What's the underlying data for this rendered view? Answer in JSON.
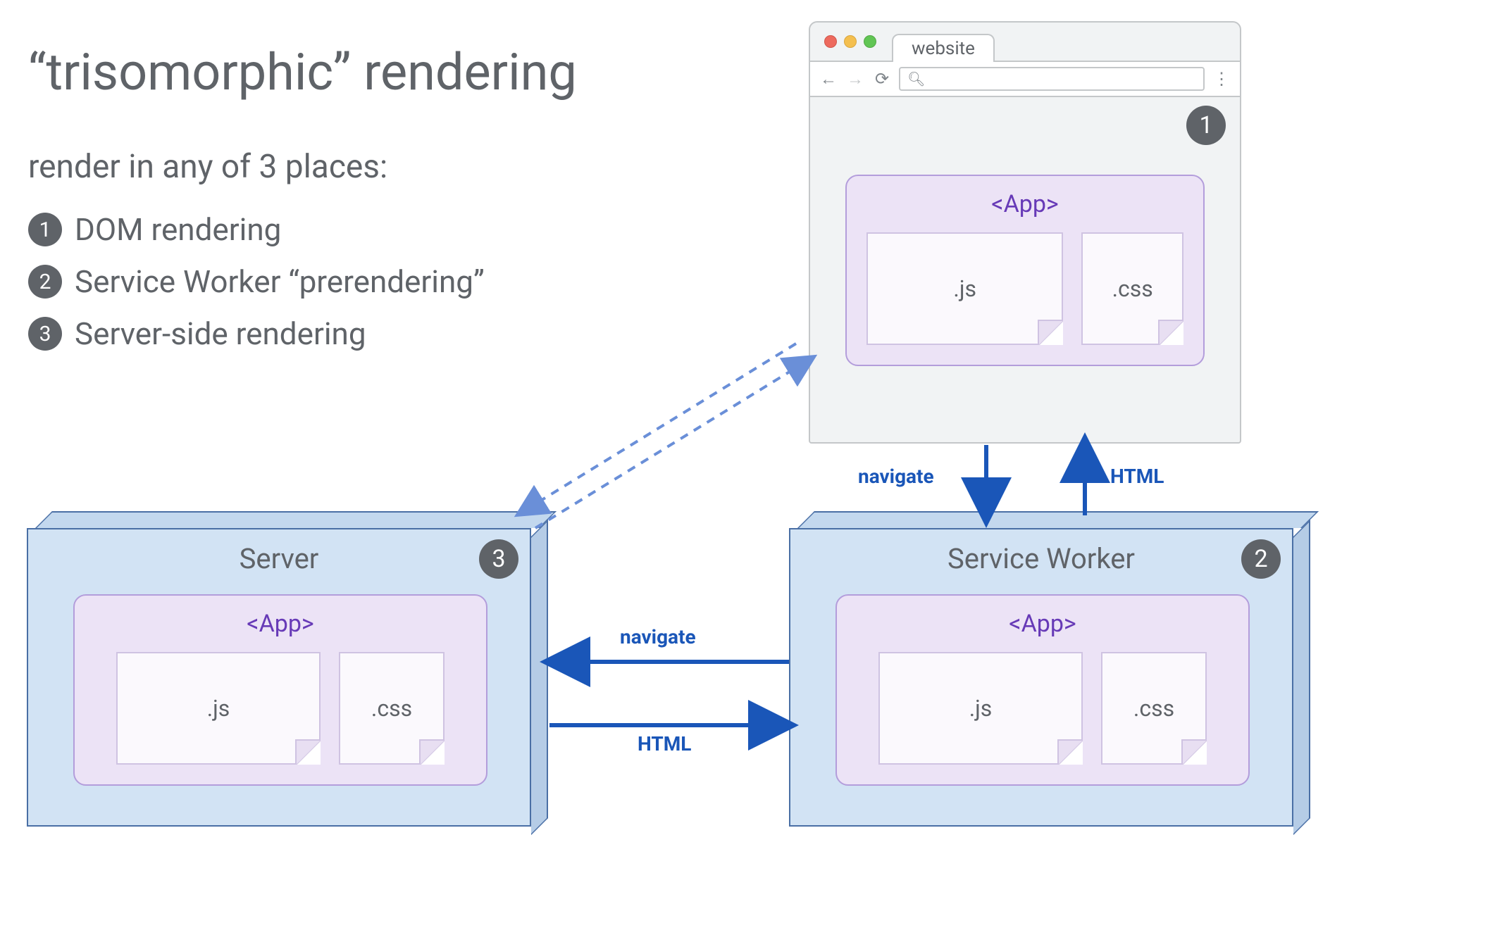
{
  "title": "“trisomorphic” rendering",
  "subtitle": "render in any of 3 places:",
  "bullets": [
    {
      "num": "1",
      "text": "DOM rendering"
    },
    {
      "num": "2",
      "text": "Service Worker “prerendering”"
    },
    {
      "num": "3",
      "text": "Server-side rendering"
    }
  ],
  "browser": {
    "tab": "website",
    "badge": "1",
    "app_label": "<App>",
    "file_js": ".js",
    "file_css": ".css",
    "search_glyph": "🔍︎"
  },
  "server": {
    "title": "Server",
    "badge": "3",
    "app_label": "<App>",
    "file_js": ".js",
    "file_css": ".css"
  },
  "service_worker": {
    "title": "Service Worker",
    "badge": "2",
    "app_label": "<App>",
    "file_js": ".js",
    "file_css": ".css"
  },
  "arrows": {
    "browser_sw_down": "navigate",
    "browser_sw_up": "HTML",
    "sw_server_left": "navigate",
    "sw_server_right": "HTML"
  },
  "colors": {
    "text": "#5f6368",
    "badge_bg": "#5f6368",
    "purple_fill": "#ece3f6",
    "purple_border": "#b39ddb",
    "purple_text": "#673ab7",
    "blue_fill": "#d2e3f4",
    "blue_border": "#4a6fa5",
    "arrow": "#1a56b8"
  }
}
